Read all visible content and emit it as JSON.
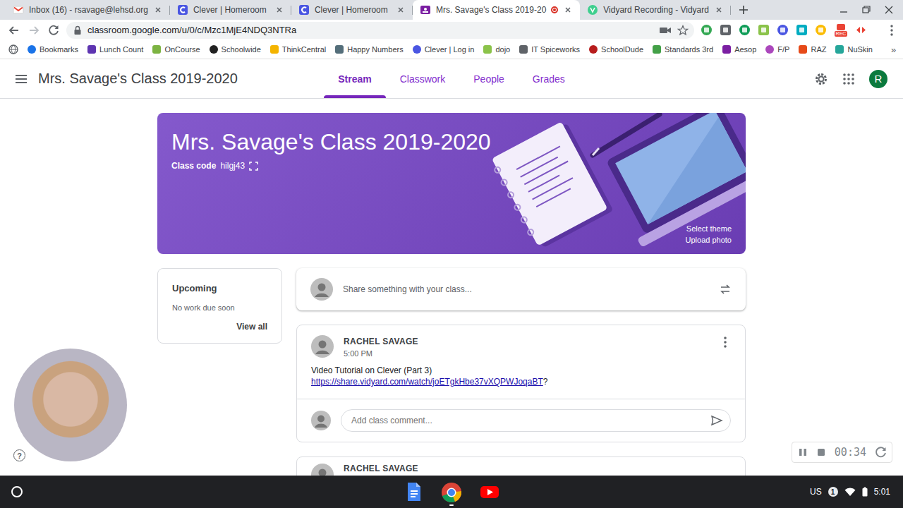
{
  "tabs": [
    {
      "label": "Inbox (16) - rsavage@lehsd.org",
      "kind": "gmail",
      "selected": false,
      "recording": false
    },
    {
      "label": "Clever | Homeroom",
      "kind": "clever",
      "selected": false,
      "recording": false
    },
    {
      "label": "Clever | Homeroom",
      "kind": "clever",
      "selected": false,
      "recording": false
    },
    {
      "label": "Mrs. Savage's Class 2019-20",
      "kind": "classroom",
      "selected": true,
      "recording": true
    },
    {
      "label": "Vidyard Recording - Vidyard",
      "kind": "vidyard",
      "selected": false,
      "recording": false
    }
  ],
  "toolbar": {
    "url": "classroom.google.com/u/0/c/Mzc1MjE4NDQ3NTRa",
    "extension_badge": "REC"
  },
  "bookmarks": {
    "items": [
      {
        "label": "Bookmarks",
        "color": "#1a73e8"
      },
      {
        "label": "Lunch Count",
        "color": "#5e35b1"
      },
      {
        "label": "OnCourse",
        "color": "#7cb342"
      },
      {
        "label": "Schoolwide",
        "color": "#212121"
      },
      {
        "label": "ThinkCentral",
        "color": "#f4b400"
      },
      {
        "label": "Happy Numbers",
        "color": "#546e7a"
      },
      {
        "label": "Clever | Log in",
        "color": "#4a56e2"
      },
      {
        "label": "dojo",
        "color": "#8bc34a"
      },
      {
        "label": "IT Spiceworks",
        "color": "#5f6368"
      },
      {
        "label": "SchoolDude",
        "color": "#b71c1c"
      },
      {
        "label": "Standards 3rd",
        "color": "#43a047"
      },
      {
        "label": "Aesop",
        "color": "#7b1fa2"
      },
      {
        "label": "F/P",
        "color": "#ab47bc"
      },
      {
        "label": "RAZ",
        "color": "#e64a19"
      },
      {
        "label": "NuSkin",
        "color": "#26a69a"
      }
    ],
    "more": "»"
  },
  "classroom": {
    "title": "Mrs. Savage's Class 2019-2020",
    "nav": [
      {
        "label": "Stream",
        "selected": true
      },
      {
        "label": "Classwork",
        "selected": false
      },
      {
        "label": "People",
        "selected": false
      },
      {
        "label": "Grades",
        "selected": false
      }
    ],
    "avatar": "R"
  },
  "banner": {
    "title": "Mrs. Savage's Class 2019-2020",
    "class_code_label": "Class code",
    "class_code": "hilgj43",
    "links": [
      "Select theme",
      "Upload photo"
    ]
  },
  "upcoming": {
    "title": "Upcoming",
    "status": "No work due soon",
    "link": "View all"
  },
  "share": {
    "placeholder": "Share something with your class..."
  },
  "posts": [
    {
      "author": "RACHEL SAVAGE",
      "time": "5:00 PM",
      "text": "Video Tutorial on Clever (Part 3)",
      "link": "https://share.vidyard.com/watch/joETgkHbe37vXQPWJoqaBT",
      "link_suffix": "?",
      "comment_placeholder": "Add class comment..."
    },
    {
      "author": "RACHEL SAVAGE"
    }
  ],
  "help": "?",
  "recorder": {
    "elapsed": "00:34"
  },
  "shelf": {
    "keyboard": "US",
    "notifications": "1",
    "time": "5:01"
  }
}
